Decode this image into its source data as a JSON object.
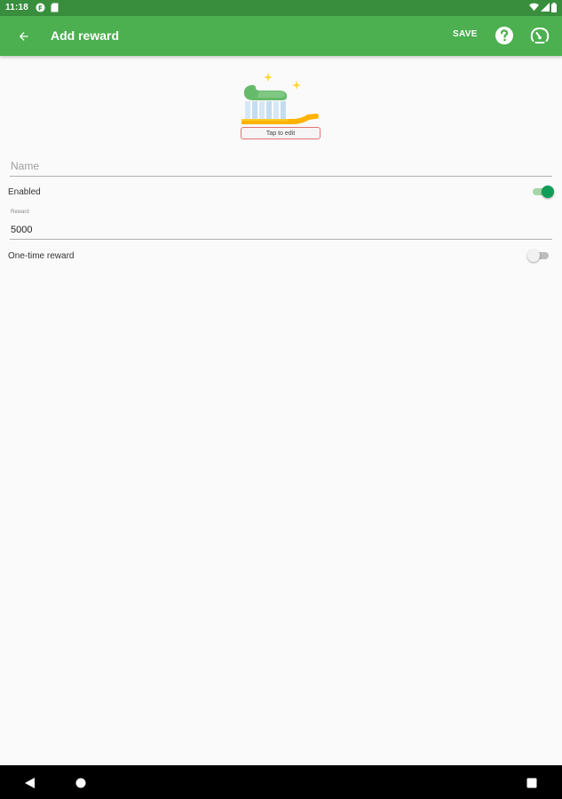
{
  "status_bar": {
    "time": "11:18",
    "icons_left": [
      "notification-app-icon",
      "sd-card-icon"
    ],
    "icons_right": [
      "wifi-icon",
      "cell-signal-icon",
      "battery-icon"
    ]
  },
  "app_bar": {
    "title": "Add reward",
    "save_label": "SAVE",
    "back_icon": "arrow-back-icon",
    "help_icon": "help-circle-icon",
    "stats_icon": "gauge-icon",
    "color": "#4caf50",
    "status_color": "#388e3c"
  },
  "reward_image": {
    "icon": "toothbrush-icon",
    "caption": "Tap to edit"
  },
  "form": {
    "name": {
      "placeholder": "Name",
      "value": ""
    },
    "enabled": {
      "label": "Enabled",
      "checked": true
    },
    "reward": {
      "label": "Reward",
      "value": "5000"
    },
    "one_time": {
      "label": "One-time reward",
      "checked": false
    }
  },
  "accent_color": "#0f9d58",
  "nav_bar": {
    "icons": [
      "nav-back-icon",
      "nav-home-icon",
      "nav-recents-icon"
    ]
  }
}
